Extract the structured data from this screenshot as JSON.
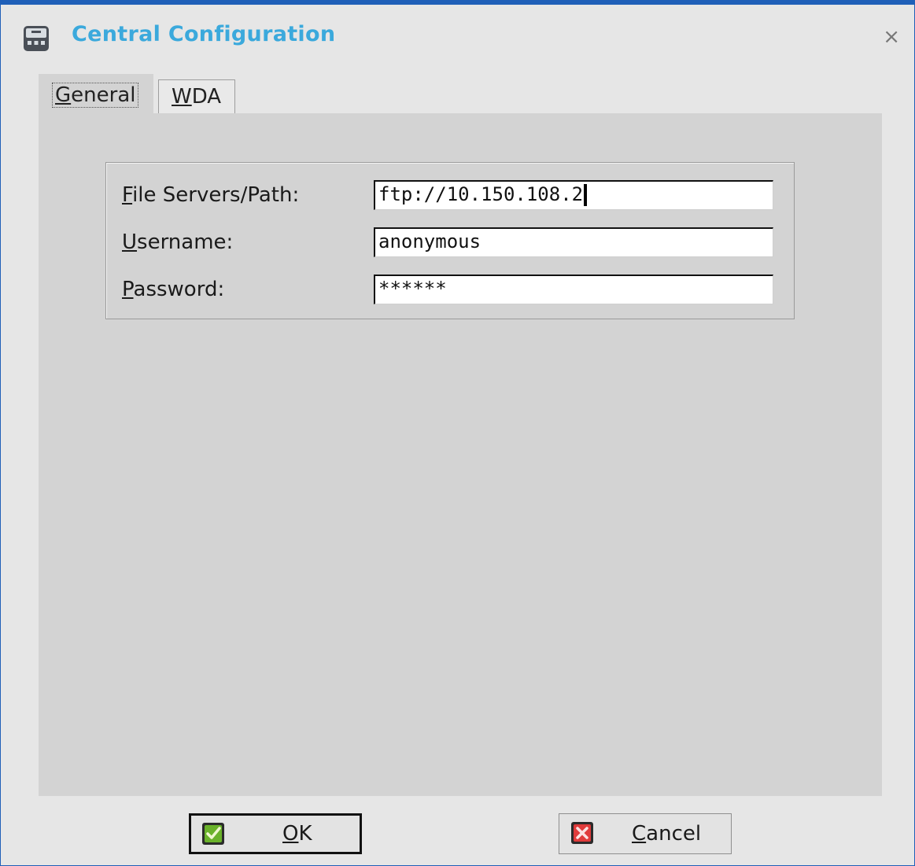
{
  "window": {
    "title": "Central Configuration",
    "close_glyph": "×"
  },
  "tabs": [
    {
      "label": "General",
      "mnemonic": "G",
      "rest": "eneral",
      "active": true
    },
    {
      "label": "WDA",
      "mnemonic": "W",
      "rest": "DA",
      "active": false
    }
  ],
  "form": {
    "file_servers": {
      "label_mnemonic": "F",
      "label_rest": "ile Servers/Path:",
      "value": "ftp://10.150.108.2"
    },
    "username": {
      "label_mnemonic": "U",
      "label_rest": "sername:",
      "value": "anonymous"
    },
    "password": {
      "label_mnemonic": "P",
      "label_rest": "assword:",
      "value": "******"
    }
  },
  "buttons": {
    "ok": {
      "mnemonic": "O",
      "rest": "K",
      "icon": "check-icon"
    },
    "cancel": {
      "mnemonic": "C",
      "rest": "ancel",
      "icon": "x-icon"
    }
  },
  "colors": {
    "title": "#3ba9dc",
    "border": "#1f5fb8",
    "ok_icon": "#6ab22a",
    "cancel_icon": "#e03b3b"
  }
}
